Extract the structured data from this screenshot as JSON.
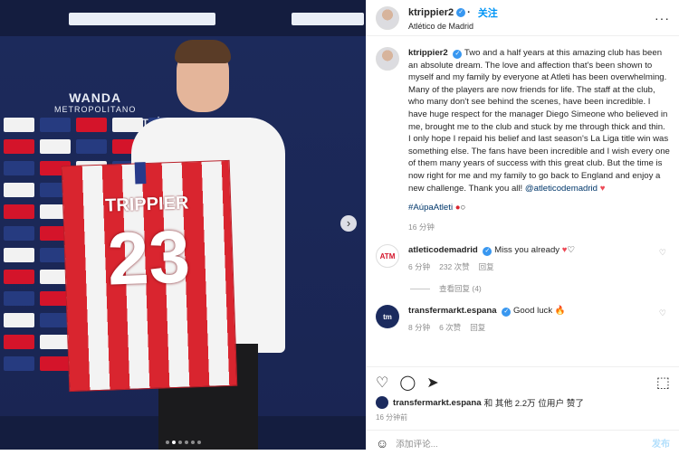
{
  "photo": {
    "jersey_name": "TRIPPIER",
    "jersey_number": "23",
    "brand_text_1": "WANDA",
    "brand_text_2": "METROPOLITANO",
    "brand_text_3": "ATLÉTICO",
    "carousel_dots": 6,
    "active_dot": 2
  },
  "header": {
    "username": "ktrippier2",
    "follow_label": "关注",
    "location": "Atlético de Madrid"
  },
  "caption": {
    "username": "ktrippier2",
    "text": "Two and a half years at this amazing club has been an absolute dream. The love and affection that's been shown to myself and my family by everyone at Atleti has been overwhelming. Many of the players are now friends for life. The staff at the club, who many don't see behind the scenes, have been incredible. I have huge respect for the manager Diego Simeone who believed in me, brought me to the club and stuck by me through thick and thin. I only hope I repaid his belief and last season's La Liga title win was something else. The fans have been incredible and I wish every one of them many years of success with this great club. But the time is now right for me and my family to go back to England and enjoy a new challenge. Thank you all! ",
    "mention": "@atleticodemadrid",
    "hashtag": "#AúpaAtleti",
    "time": "16 分钟"
  },
  "comments": [
    {
      "username": "atleticodemadrid",
      "avatar_text": "ATM",
      "text": "Miss you already",
      "time": "6 分钟",
      "likes": "232 次赞",
      "reply": "回复",
      "view_replies": "查看回复 (4)"
    },
    {
      "username": "transfermarkt.espana",
      "avatar_text": "tm",
      "text": "Good luck",
      "time": "8 分钟",
      "likes": "6 次赞",
      "reply": "回复"
    }
  ],
  "actions": {
    "liked_by_user": "transfermarkt.espana",
    "liked_by_rest": "和 其他 2.2万 位用户 赞了",
    "time_ago": "16 分钟前",
    "comment_placeholder": "添加评论...",
    "post_label": "发布"
  },
  "colors": {
    "accent": "#0095f6",
    "verified": "#3897f0",
    "heart": "#ed4956",
    "atletico_red": "#d9252f"
  }
}
